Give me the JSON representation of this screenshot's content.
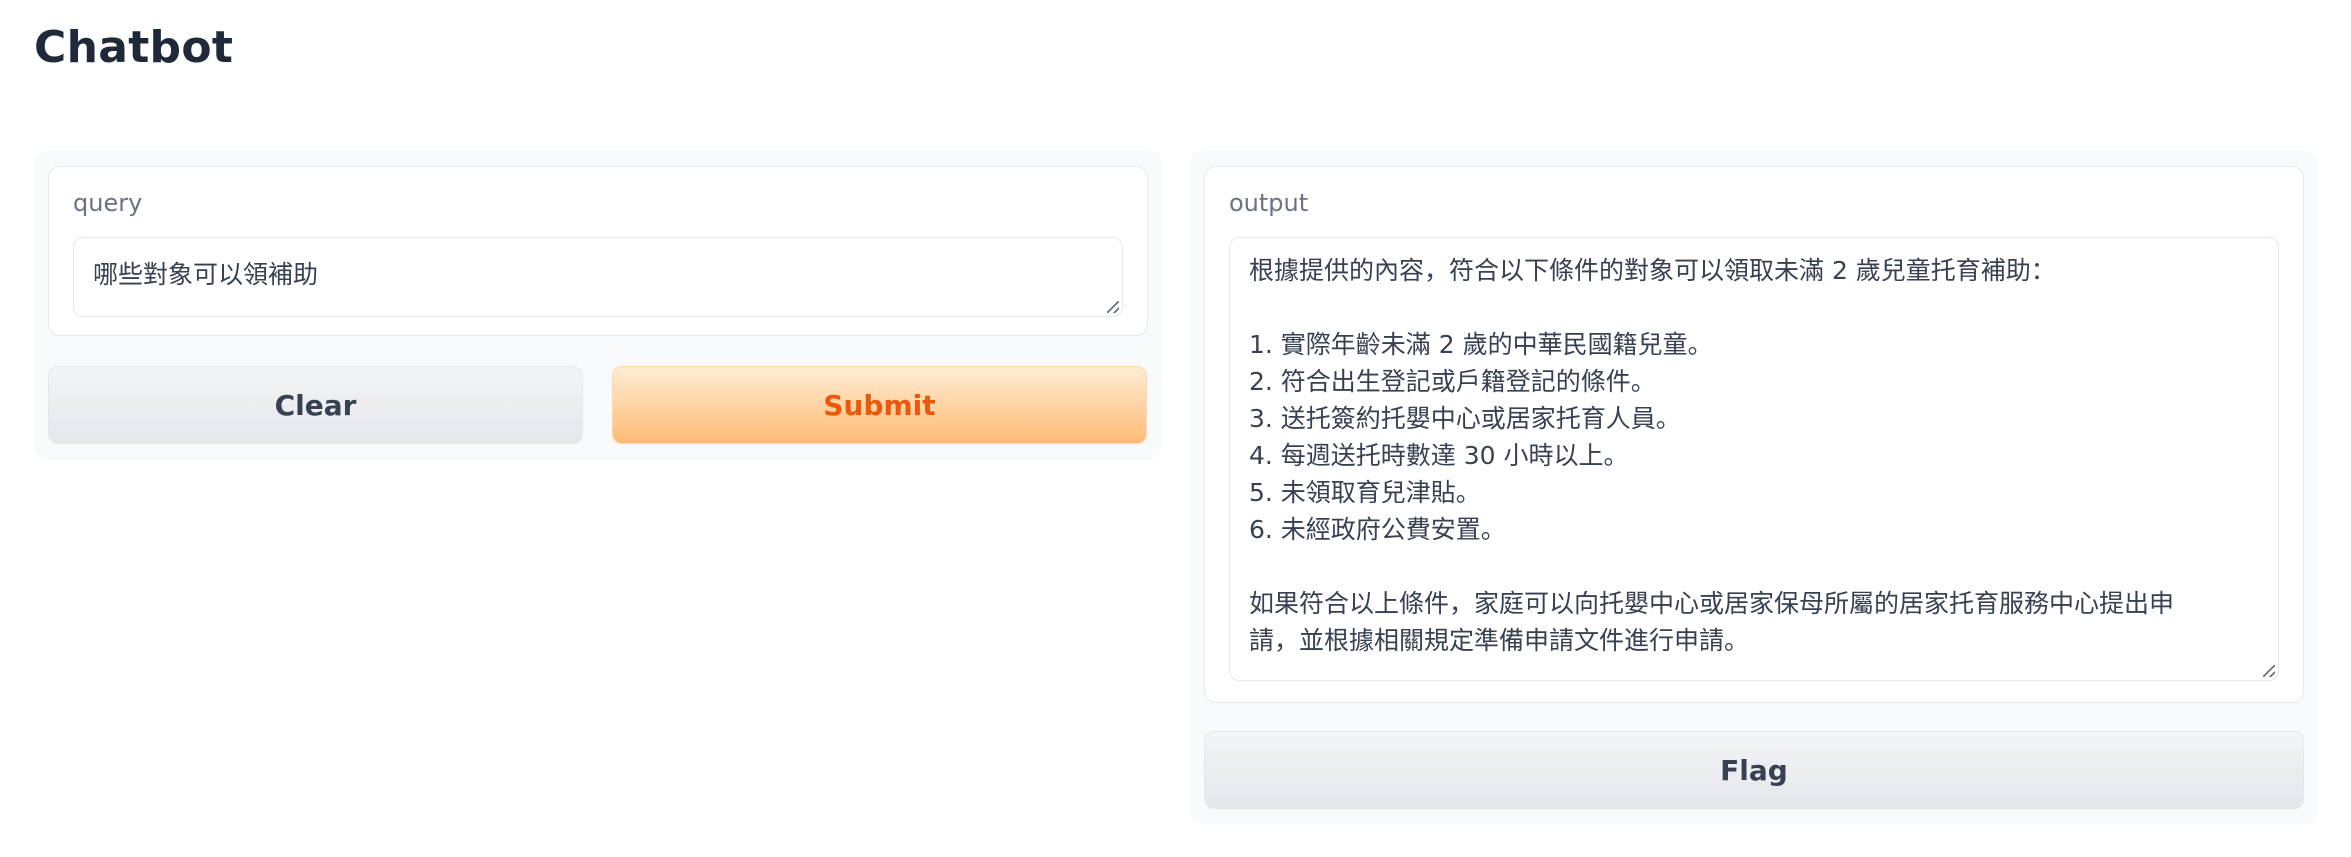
{
  "app": {
    "title": "Chatbot"
  },
  "input": {
    "label": "query",
    "value": "哪些對象可以領補助"
  },
  "actions": {
    "clear_label": "Clear",
    "submit_label": "Submit",
    "flag_label": "Flag"
  },
  "output": {
    "label": "output",
    "lines": [
      "根據提供的內容，符合以下條件的對象可以領取未滿 2 歲兒童托育補助：",
      "",
      "1. 實際年齡未滿 2 歲的中華民國籍兒童。",
      "2. 符合出生登記或戶籍登記的條件。",
      "3. 送托簽約托嬰中心或居家托育人員。",
      "4. 每週送托時數達 30 小時以上。",
      "5. 未領取育兒津貼。",
      "6. 未經政府公費安置。",
      "",
      "如果符合以上條件，家庭可以向托嬰中心或居家保母所屬的居家托育服務中心提出申",
      "請，並根據相關規定準備申請文件進行申請。"
    ]
  },
  "colors": {
    "primary_button_text": "#ea580c",
    "primary_button_gradient_top": "#ffedd5",
    "primary_button_gradient_bottom": "#fdba74",
    "secondary_button_bg": "#e5e7eb"
  }
}
